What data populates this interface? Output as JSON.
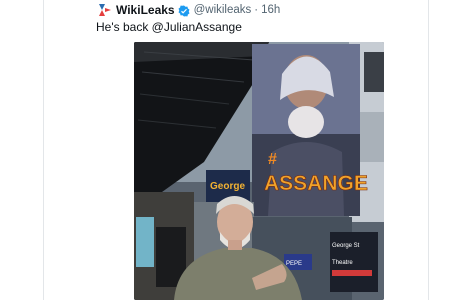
{
  "tweet": {
    "author_name": "WikiLeaks",
    "handle": "@wikileaks",
    "separator": "·",
    "time": "16h",
    "text": "He's back @JulianAssange",
    "verified": true,
    "verified_color": "#1d9bf0",
    "logo_icon": "wikileaks-hourglass-logo"
  },
  "media": {
    "mural_hashtag": "#",
    "mural_text": "ASSANGE",
    "sign_left": "George",
    "sign_right_1": "George St",
    "sign_right_2": "Theatre",
    "sign_small": "PEPE"
  }
}
